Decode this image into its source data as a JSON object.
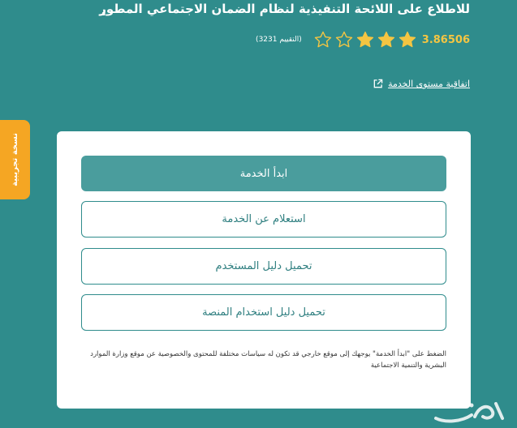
{
  "header": {
    "title": "للاطلاع على اللائحة التنفيذية لنظام الضمان الاجتماعي المطور",
    "title_dot": "."
  },
  "rating": {
    "value": "3.86506",
    "count_label": "(التقييم 3231)",
    "stars_filled": 3,
    "stars_total": 5,
    "star_color": "#f4c542"
  },
  "sla_link": {
    "label": "اتفاقية مستوى الخدمة",
    "icon": "external-link-icon"
  },
  "trial_tab": {
    "label": "نسخة تجريبية",
    "color": "#f5a623"
  },
  "card": {
    "start_button": "ابدأ الخدمة",
    "inquiry_button": "استعلام عن الخدمة",
    "user_guide_button": "تحميل دليل المستخدم",
    "platform_guide_button": "تحميل دليل استخدام المنصة",
    "note": "الضغط على \"ابدأ الخدمة\" يوجهك إلى موقع خارجي قد تكون له سياسات مختلفة للمحتوى والخصوصية عن موقع وزارة الموارد البشرية والتنمية الاجتماعية"
  },
  "theme": {
    "background": "#2f8c8c",
    "primary_button": "#4a9d9d"
  }
}
